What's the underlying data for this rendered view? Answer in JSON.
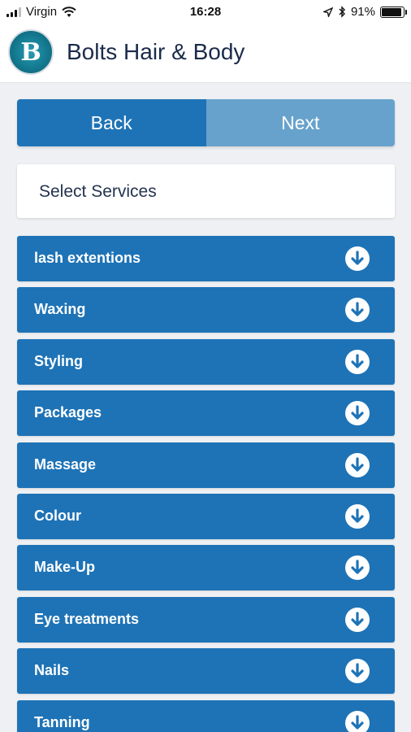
{
  "status_bar": {
    "carrier": "Virgin",
    "time": "16:28",
    "battery": "91%",
    "battery_level": 0.91,
    "icons": [
      "signal-icon",
      "wifi-icon",
      "location-icon",
      "bluetooth-icon",
      "battery-icon"
    ]
  },
  "header": {
    "title": "Bolts Hair & Body",
    "logo_letter": "B"
  },
  "nav": {
    "back_label": "Back",
    "next_label": "Next"
  },
  "select_panel": {
    "label": "Select Services"
  },
  "services": [
    {
      "label": "lash extentions"
    },
    {
      "label": "Waxing"
    },
    {
      "label": "Styling"
    },
    {
      "label": "Packages"
    },
    {
      "label": "Massage"
    },
    {
      "label": "Colour"
    },
    {
      "label": "Make-Up"
    },
    {
      "label": "Eye treatments"
    },
    {
      "label": "Nails"
    },
    {
      "label": "Tanning"
    }
  ],
  "colors": {
    "primary": "#1e73b6",
    "next_disabled": "#67a2cc",
    "background": "#eef0f3",
    "title": "#1b2b4b"
  }
}
